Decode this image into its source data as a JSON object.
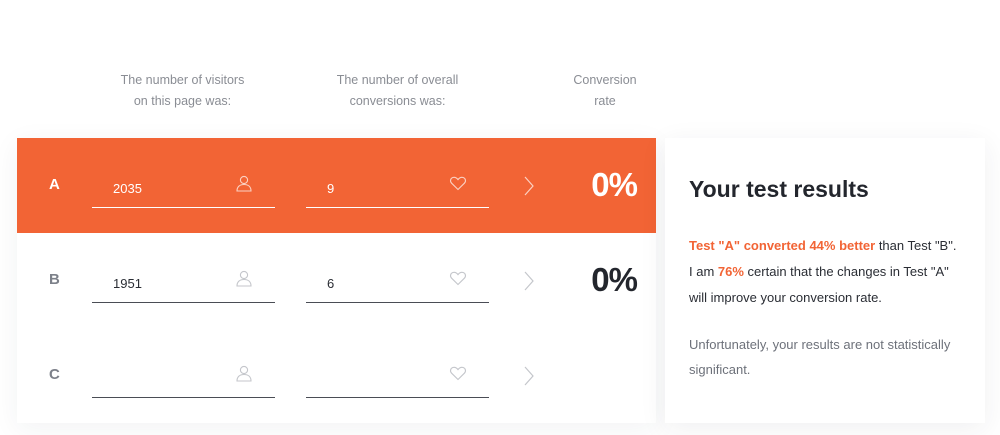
{
  "headers": {
    "visitors": [
      "The number of visitors",
      "on this page was:"
    ],
    "conversions": [
      "The number of overall",
      "conversions was:"
    ],
    "rate": [
      "Conversion",
      "rate"
    ]
  },
  "rows": [
    {
      "label": "A",
      "visitors": "2035",
      "conversions": "9",
      "rate": "0%",
      "highlighted": true
    },
    {
      "label": "B",
      "visitors": "1951",
      "conversions": "6",
      "rate": "0%",
      "highlighted": false
    },
    {
      "label": "C",
      "visitors": "",
      "conversions": "",
      "rate": "",
      "highlighted": false
    }
  ],
  "icons": {
    "visitors_field": "user-icon",
    "conversions_field": "heart-icon",
    "row_arrow": "chevron-right-icon"
  },
  "results": {
    "title": "Your test results",
    "line1_highlight": "Test \"A\" converted 44% better",
    "line1_rest": " than Test \"B\".",
    "line2_prefix": "I am ",
    "line2_highlight": "76%",
    "line2_rest": " certain that the changes in Test \"A\"",
    "line3": "will improve your conversion rate.",
    "note": "Unfortunately, your results are not statistically significant."
  },
  "colors": {
    "accent": "#f26435",
    "text_dark": "#23262d",
    "text_muted": "#8a8d94"
  }
}
